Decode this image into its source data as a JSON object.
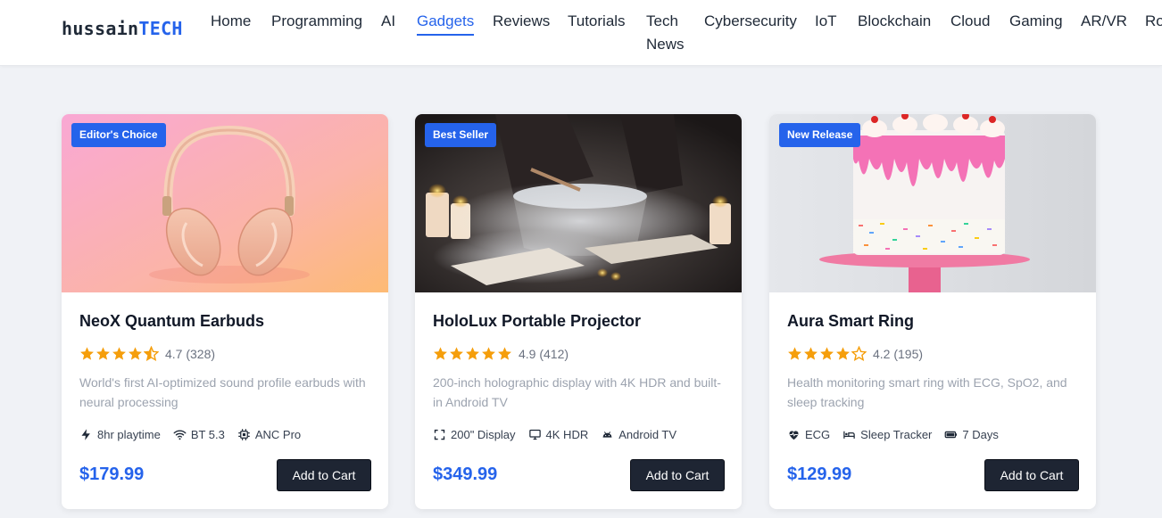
{
  "brand": {
    "name_part1": "hussain",
    "name_part2": "TECH"
  },
  "nav": {
    "items": [
      {
        "label": "Home"
      },
      {
        "label": "Programming"
      },
      {
        "label": "AI"
      },
      {
        "label": "Gadgets",
        "active": true
      },
      {
        "label": "Reviews"
      },
      {
        "label": "Tutorials"
      },
      {
        "label": "Tech"
      },
      {
        "label": "News"
      },
      {
        "label": "Cybersecurity"
      },
      {
        "label": "IoT"
      },
      {
        "label": "Blockchain"
      },
      {
        "label": "Cloud"
      },
      {
        "label": "Gaming"
      },
      {
        "label": "AR/VR"
      },
      {
        "label": "Ro"
      }
    ]
  },
  "products": [
    {
      "badge": "Editor's Choice",
      "title": "NeoX Quantum Earbuds",
      "rating_value": 4.7,
      "rating_text": "4.7 (328)",
      "description": "World's first AI-optimized sound profile earbuds with neural processing",
      "features": [
        {
          "icon": "bolt-icon",
          "label": "8hr playtime"
        },
        {
          "icon": "wifi-icon",
          "label": "BT 5.3"
        },
        {
          "icon": "chip-icon",
          "label": "ANC Pro"
        }
      ],
      "price": "$179.99",
      "cta": "Add to Cart"
    },
    {
      "badge": "Best Seller",
      "title": "HoloLux Portable Projector",
      "rating_value": 4.9,
      "rating_text": "4.9 (412)",
      "description": "200-inch holographic display with 4K HDR and built-in Android TV",
      "features": [
        {
          "icon": "expand-icon",
          "label": "200\" Display"
        },
        {
          "icon": "monitor-icon",
          "label": "4K HDR"
        },
        {
          "icon": "android-icon",
          "label": "Android TV"
        }
      ],
      "price": "$349.99",
      "cta": "Add to Cart"
    },
    {
      "badge": "New Release",
      "title": "Aura Smart Ring",
      "rating_value": 4.2,
      "rating_text": "4.2 (195)",
      "description": "Health monitoring smart ring with ECG, SpO2, and sleep tracking",
      "features": [
        {
          "icon": "heart-pulse-icon",
          "label": "ECG"
        },
        {
          "icon": "bed-icon",
          "label": "Sleep Tracker"
        },
        {
          "icon": "battery-icon",
          "label": "7 Days"
        }
      ],
      "price": "$129.99",
      "cta": "Add to Cart"
    }
  ],
  "colors": {
    "accent": "#2563eb",
    "star": "#f59e0b",
    "button": "#1e2533"
  }
}
